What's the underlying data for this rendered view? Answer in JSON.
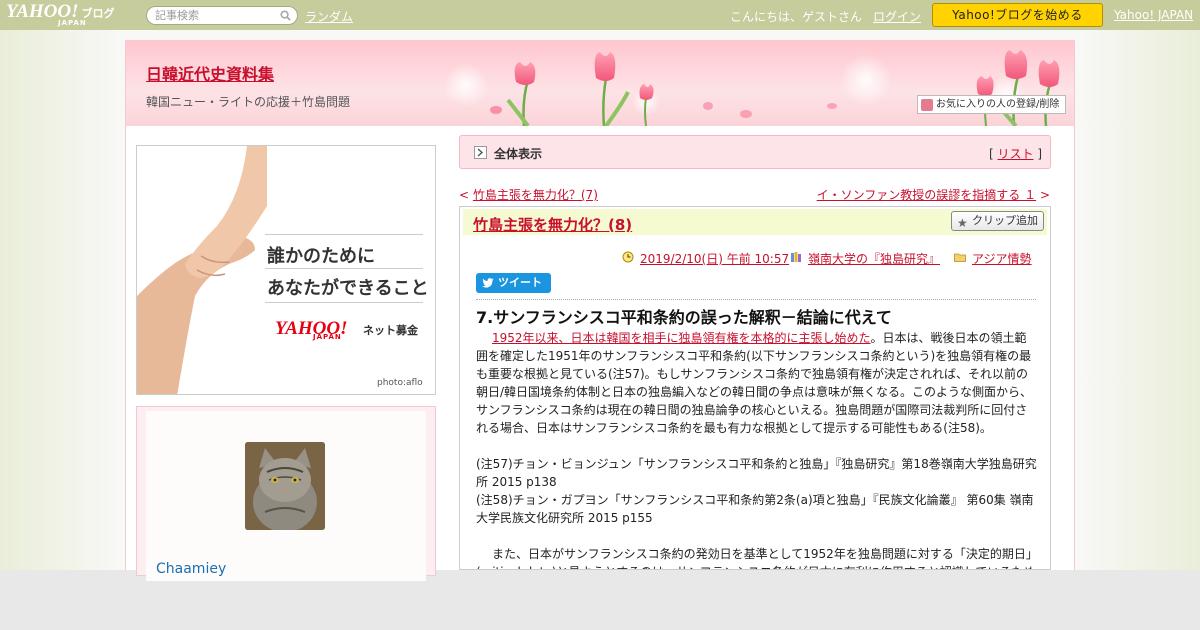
{
  "topbar": {
    "logo_main": "YAHOO!",
    "logo_japan": "JAPAN",
    "logo_blog": "ブログ",
    "search_placeholder": "記事検索",
    "random": "ランダム",
    "greeting": "こんにちは、ゲストさん",
    "login": "ログイン",
    "start_blog": "Yahoo!ブログを始める",
    "yahoo_japan": "Yahoo! JAPAN"
  },
  "header": {
    "title": "日韓近代史資料集",
    "subtitle": "韓国ニュー・ライトの応援＋竹島問題",
    "fav_button": "お気に入りの人の登録/削除"
  },
  "ad": {
    "line1": "誰かのために",
    "line2": "あなたができること",
    "brand": "YAHOO!",
    "brand_japan": "JAPAN",
    "service": "ネット募金",
    "credit": "photo:aflo"
  },
  "profile": {
    "name": "Chaamiey"
  },
  "listbar": {
    "all": "全体表示",
    "list_prefix": "[ ",
    "list": "リスト",
    "list_suffix": " ]"
  },
  "nav": {
    "prev": "竹島主張を無力化？(7)",
    "next": "イ・ソンファン教授の誤謬を指摘する １"
  },
  "post": {
    "title": "竹島主張を無力化？(8)",
    "clip": "クリップ追加",
    "date": "2019/2/10(日) 午前 10:57",
    "category": "嶺南大学の『独島研究』",
    "folder": "アジア情勢",
    "tweet": "ツイート",
    "heading": "7.サンフランシスコ平和条約の誤った解釈－結論に代えて",
    "para1_link": "1952年以来、日本は韓国を相手に独島領有権を本格的に主張し始めた",
    "para1_rest": "。日本は、戦後日本の領土範囲を確定した1951年のサンフランシスコ平和条約(以下サンフランシスコ条約という)を独島領有権の最も重要な根拠と見ている(注57)。もしサンフランシスコ条約で独島領有権が決定されれば、それ以前の朝日/韓日国境条約体制と日本の独島編入などの韓日間の争点は意味が無くなる。このような側面から、サンフランシスコ条約は現在の韓日間の独島論争の核心といえる。独島問題が国際司法裁判所に回付される場合、日本はサンフランシスコ条約を最も有力な根拠として提示する可能性もある(注58)。",
    "note57": "(注57)チョン・ビョンジュン「サンフランシスコ平和条約と独島」『独島研究』第18巻嶺南大学独島研究所 2015 p138",
    "note58": "(注58)チョン・ガプヨン「サンフランシスコ平和条約第2条(a)項と独島」『民族文化論叢』 第60集 嶺南大学民族文化研究所 2015 p155",
    "para2": "また、日本がサンフランシスコ条約の発効日を基準として1952年を独島問題に対する「決定的期日」(critical date)と見ようとするのは、サンフランシスコ条約が日本に有利に作用すると認識しているため"
  }
}
